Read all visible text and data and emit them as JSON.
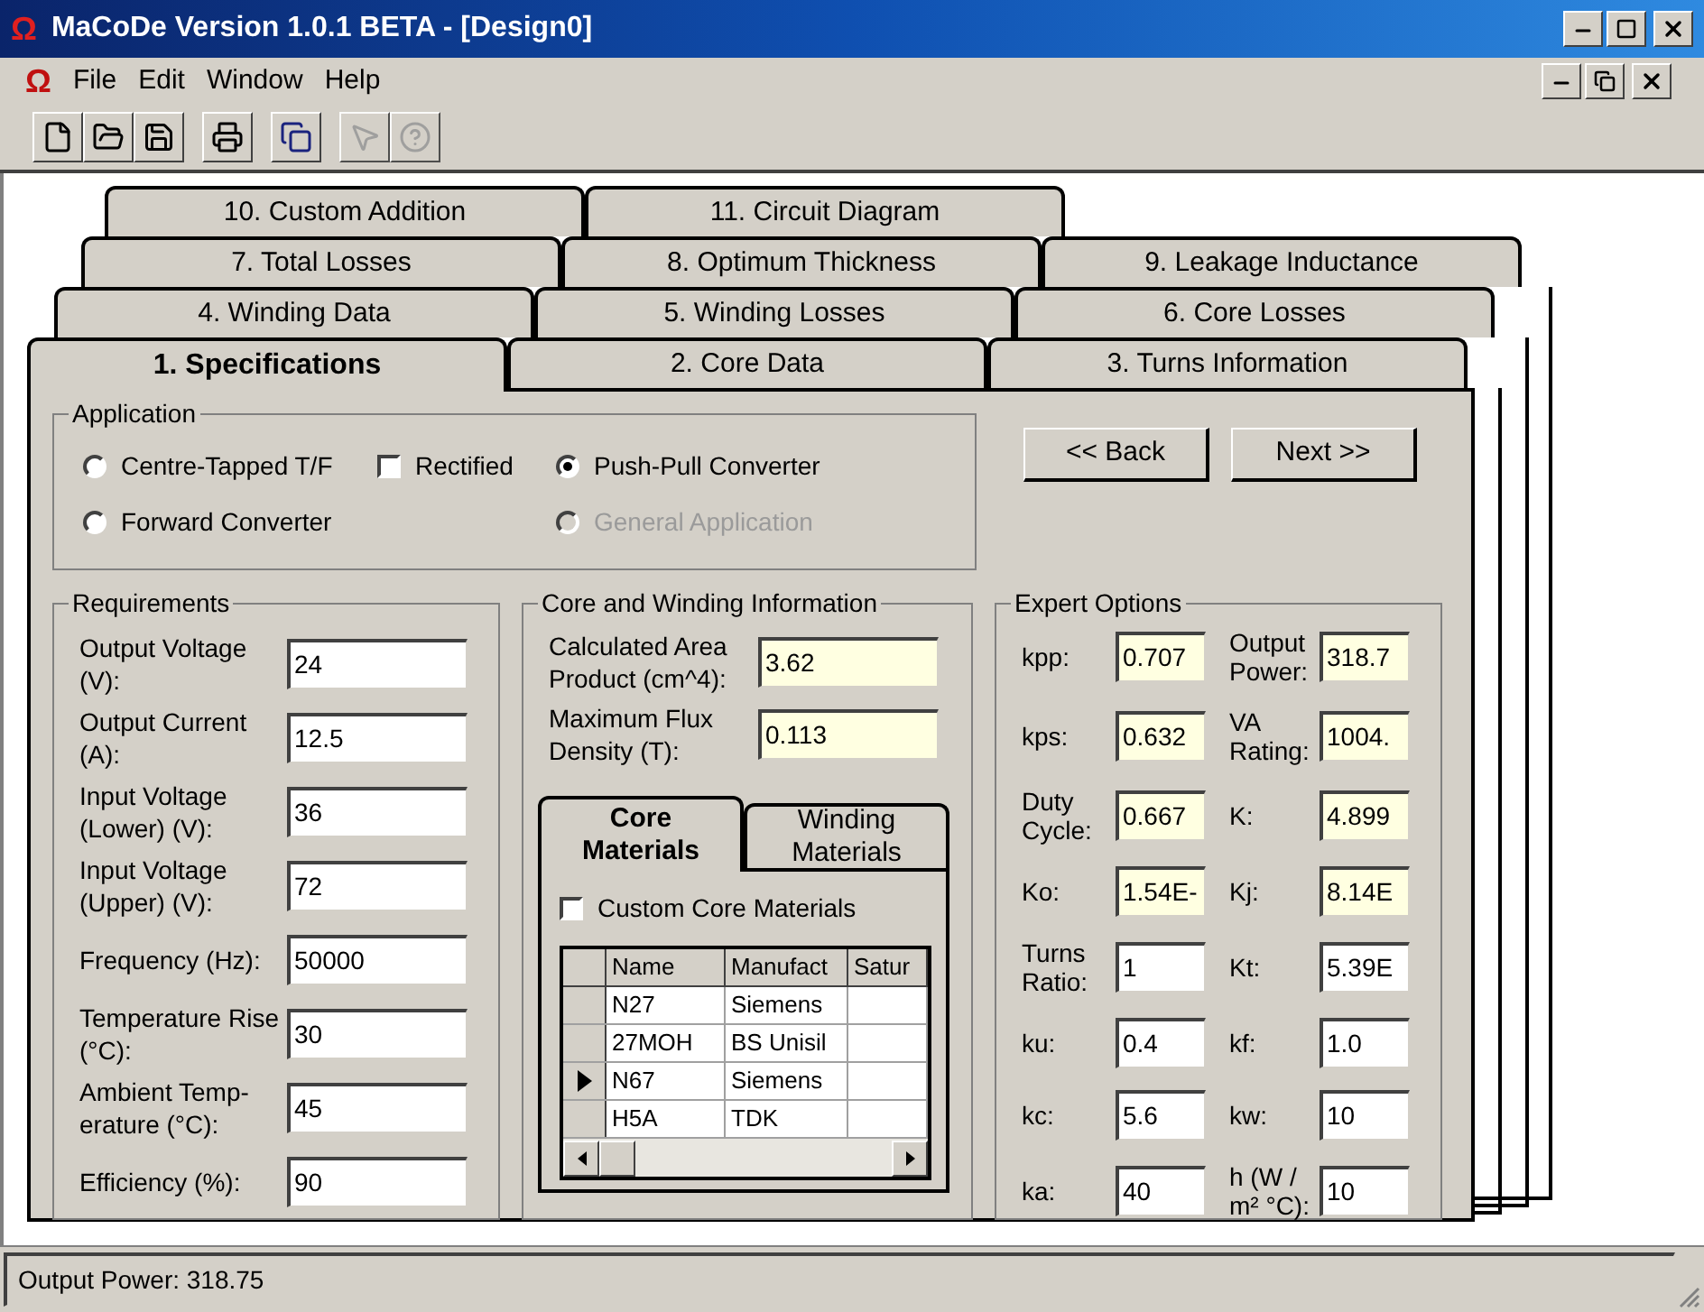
{
  "window": {
    "icon": "Ω",
    "title": "MaCoDe Version 1.0.1 BETA - [Design0]"
  },
  "menu_bar": {
    "icon": "Ω",
    "items": [
      {
        "label": "File"
      },
      {
        "label": "Edit"
      },
      {
        "label": "Window"
      },
      {
        "label": "Help"
      }
    ]
  },
  "toolbar": [
    {
      "kind": "new",
      "disabled": false
    },
    {
      "kind": "open",
      "disabled": false
    },
    {
      "kind": "save",
      "disabled": false
    },
    {
      "kind": "print",
      "disabled": false
    },
    {
      "kind": "copy",
      "disabled": false
    },
    {
      "kind": "whatsthis",
      "disabled": true
    },
    {
      "kind": "help",
      "disabled": true
    }
  ],
  "tab_rows": [
    [
      {
        "label": "10. Custom Addition",
        "selected": false
      },
      {
        "label": "11.  Circuit Diagram",
        "selected": false
      }
    ],
    [
      {
        "label": "7.  Total Losses",
        "selected": false
      },
      {
        "label": "8.  Optimum Thickness",
        "selected": false
      },
      {
        "label": "9.  Leakage Inductance",
        "selected": false
      }
    ],
    [
      {
        "label": "4.  Winding Data",
        "selected": false
      },
      {
        "label": "5.  Winding Losses",
        "selected": false
      },
      {
        "label": "6.  Core Losses",
        "selected": false
      }
    ],
    [
      {
        "label": "1.  Specifications",
        "selected": true
      },
      {
        "label": "2.  Core Data",
        "selected": false
      },
      {
        "label": "3.  Turns Information",
        "selected": false
      }
    ]
  ],
  "application": {
    "title": "Application",
    "rows": [
      [
        {
          "kind": "radio",
          "label": "Centre-Tapped T/F",
          "selected": false,
          "disabled": false
        },
        {
          "kind": "checkbox",
          "label": "Rectified",
          "checked": false
        },
        {
          "kind": "radio",
          "label": "Push-Pull Converter",
          "selected": true,
          "disabled": false
        }
      ],
      [
        {
          "kind": "radio",
          "label": "Forward Converter",
          "selected": false,
          "disabled": false
        },
        {
          "kind": "blank"
        },
        {
          "kind": "radio",
          "label": "General Application",
          "selected": false,
          "disabled": true
        }
      ]
    ]
  },
  "nav_buttons": [
    {
      "label": "<< Back"
    },
    {
      "label": "Next >>"
    }
  ],
  "requirements": {
    "title": "Requirements",
    "fields": [
      {
        "label": "Output Voltage (V):",
        "value": "24"
      },
      {
        "label": "Output Current (A):",
        "value": "12.5"
      },
      {
        "label": "Input Voltage (Lower) (V):",
        "value": "36"
      },
      {
        "label": "Input Voltage (Upper) (V):",
        "value": "72"
      },
      {
        "label": "Frequency (Hz):",
        "value": "50000"
      },
      {
        "label": "Temperature Rise (°C):",
        "value": "30"
      },
      {
        "label": "Ambient Temp-erature (°C):",
        "value": "45"
      },
      {
        "label": "Efficiency (%):",
        "value": "90"
      }
    ]
  },
  "core_winding": {
    "title": "Core and Winding Information",
    "fields": [
      {
        "label": "Calculated Area Product (cm^4):",
        "value": "3.62",
        "readonly": true
      },
      {
        "label": "Maximum Flux Density (T):",
        "value": "0.113",
        "readonly": true
      }
    ],
    "subtabs": [
      {
        "label": "Core Materials",
        "selected": true
      },
      {
        "label": "Winding Materials",
        "selected": false
      }
    ],
    "custom_checkbox": {
      "label": "Custom Core Materials",
      "checked": false
    },
    "table": {
      "columns": [
        "Name",
        "Manufact",
        "Satur"
      ],
      "rows": [
        {
          "cells": [
            "N27",
            "Siemens",
            ""
          ],
          "selected": false
        },
        {
          "cells": [
            "27MOH",
            "BS Unisil",
            ""
          ],
          "selected": false
        },
        {
          "cells": [
            "N67",
            "Siemens",
            ""
          ],
          "selected": true
        },
        {
          "cells": [
            "H5A",
            "TDK",
            ""
          ],
          "selected": false
        }
      ]
    }
  },
  "expert": {
    "title": "Expert Options",
    "fields": [
      {
        "label": "kpp:",
        "value": "0.707",
        "readonly": true
      },
      {
        "label": "Output Power:",
        "value": "318.7",
        "readonly": true
      },
      {
        "label": "kps:",
        "value": "0.632",
        "readonly": true
      },
      {
        "label": "VA Rating:",
        "value": "1004.",
        "readonly": true
      },
      {
        "label": "Duty Cycle:",
        "value": "0.667",
        "readonly": true
      },
      {
        "label": "K:",
        "value": "4.899",
        "readonly": true
      },
      {
        "label": "Ko:",
        "value": "1.54E-",
        "readonly": true
      },
      {
        "label": "Kj:",
        "value": "8.14E",
        "readonly": true
      },
      {
        "label": "Turns Ratio:",
        "value": "1",
        "readonly": false
      },
      {
        "label": "Kt:",
        "value": "5.39E",
        "readonly": false
      },
      {
        "label": "ku:",
        "value": "0.4",
        "readonly": false
      },
      {
        "label": "kf:",
        "value": "1.0",
        "readonly": false
      },
      {
        "label": "kc:",
        "value": "5.6",
        "readonly": false
      },
      {
        "label": "kw:",
        "value": "10",
        "readonly": false
      },
      {
        "label": "ka:",
        "value": "40",
        "readonly": false
      },
      {
        "label": "h (W / m² °C):",
        "value": "10",
        "readonly": false
      }
    ]
  },
  "status_bar": {
    "text": "Output Power: 318.75"
  }
}
